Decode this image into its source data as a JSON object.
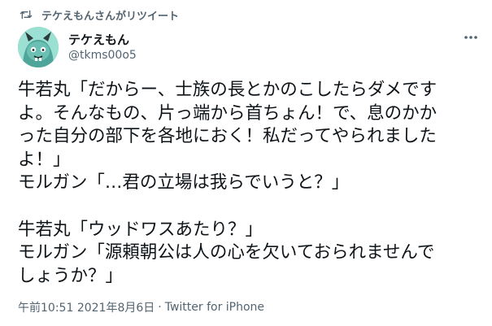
{
  "retweet": {
    "label": "テケえもんさんがリツイート",
    "icon": "retweet-icon"
  },
  "author": {
    "display_name": "テケえもん",
    "handle": "@tkms00o5",
    "avatar_icon": "avatar-character-icon"
  },
  "more_icon": "more-horizontal-icon",
  "body": {
    "lines": [
      "牛若丸「だからー、士族の長とかのこしたらダメです",
      "よ。そんなもの、片っ端から首ちょん！で、息のかか",
      "った自分の部下を各地におく！私だってやられました",
      "よ！」",
      "モルガン「…君の立場は我らでいうと？」",
      "",
      "牛若丸「ウッドワスあたり？」",
      "モルガン「源頼朝公は人の心を欠いておられませんで",
      "しょうか？」"
    ]
  },
  "meta": {
    "time": "午前10:51",
    "date": "2021年8月6日",
    "separator1": "·",
    "separator2": "·",
    "source": "Twitter for iPhone"
  },
  "colors": {
    "text": "#0f1419",
    "secondary": "#536471",
    "avatar_bg": "#9be0d2"
  }
}
